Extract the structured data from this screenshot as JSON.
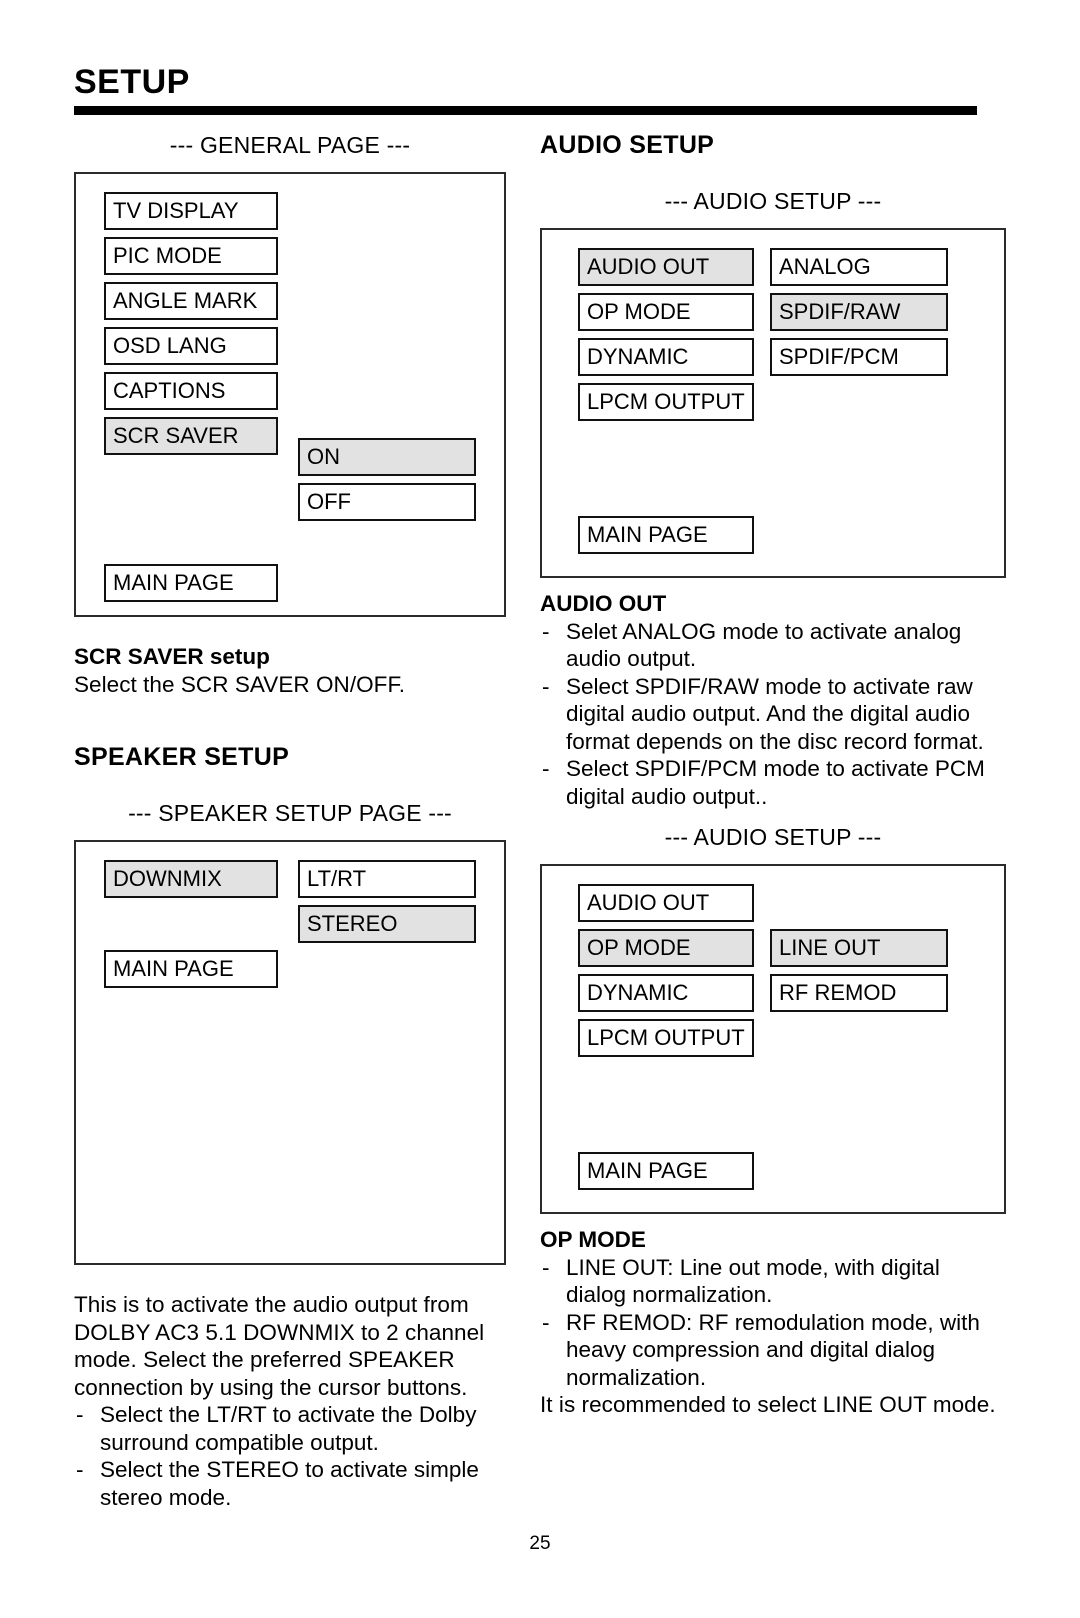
{
  "header": {
    "title": "SETUP"
  },
  "left_column": {
    "general_page": {
      "caption": "--- GENERAL PAGE ---",
      "menu_items": [
        {
          "label": "TV DISPLAY",
          "selected": false
        },
        {
          "label": "PIC MODE",
          "selected": false
        },
        {
          "label": "ANGLE MARK",
          "selected": false
        },
        {
          "label": "OSD LANG",
          "selected": false
        },
        {
          "label": "CAPTIONS",
          "selected": false
        },
        {
          "label": "SCR SAVER",
          "selected": true
        }
      ],
      "options": [
        {
          "label": "ON",
          "selected": true
        },
        {
          "label": "OFF",
          "selected": false
        }
      ],
      "main_page_label": "MAIN PAGE"
    },
    "scr_saver_setup": {
      "heading": "SCR SAVER setup",
      "body": "Select the SCR SAVER ON/OFF."
    },
    "speaker_setup": {
      "heading": "SPEAKER SETUP",
      "caption": "--- SPEAKER SETUP PAGE ---",
      "menu_items": [
        {
          "label": "DOWNMIX",
          "selected": true
        }
      ],
      "options": [
        {
          "label": "LT/RT",
          "selected": false
        },
        {
          "label": "STEREO",
          "selected": true
        }
      ],
      "main_page_label": "MAIN PAGE",
      "description": "This is to activate the audio output from DOLBY AC3 5.1 DOWNMIX to 2 channel mode.  Select the preferred SPEAKER connection by using the cursor buttons.",
      "bullets": [
        "Select the LT/RT to activate the Dolby surround compatible output.",
        "Select the STEREO to activate simple stereo mode."
      ]
    }
  },
  "right_column": {
    "audio_setup": {
      "heading": "AUDIO SETUP",
      "caption_1": "--- AUDIO SETUP ---",
      "screen_1": {
        "menu_items": [
          {
            "label": "AUDIO OUT",
            "selected": true
          },
          {
            "label": "OP MODE",
            "selected": false
          },
          {
            "label": "DYNAMIC",
            "selected": false
          },
          {
            "label": "LPCM OUTPUT",
            "selected": false
          }
        ],
        "options": [
          {
            "label": "ANALOG",
            "selected": false
          },
          {
            "label": "SPDIF/RAW",
            "selected": true
          },
          {
            "label": "SPDIF/PCM",
            "selected": false
          }
        ],
        "main_page_label": "MAIN PAGE"
      },
      "audio_out": {
        "heading": "AUDIO OUT",
        "bullets": [
          "Selet ANALOG mode to activate analog audio output.",
          "Select SPDIF/RAW mode to activate raw digital audio output. And the digital audio format depends on the disc record format.",
          "Select SPDIF/PCM mode to activate PCM digital audio output.."
        ]
      },
      "caption_2": "--- AUDIO SETUP ---",
      "screen_2": {
        "menu_items": [
          {
            "label": "AUDIO OUT",
            "selected": false
          },
          {
            "label": "OP MODE",
            "selected": true
          },
          {
            "label": "DYNAMIC",
            "selected": false
          },
          {
            "label": "LPCM OUTPUT",
            "selected": false
          }
        ],
        "options": [
          {
            "label": "LINE OUT",
            "selected": true
          },
          {
            "label": "RF REMOD",
            "selected": false
          }
        ],
        "main_page_label": "MAIN PAGE"
      },
      "op_mode": {
        "heading": "OP MODE",
        "bullets": [
          "LINE OUT: Line out mode, with digital dialog normalization.",
          "RF REMOD: RF remodulation mode, with heavy compression and digital dialog normalization."
        ],
        "footer": "It is recommended to select LINE OUT mode."
      }
    }
  },
  "footer": {
    "page_number": "25"
  }
}
